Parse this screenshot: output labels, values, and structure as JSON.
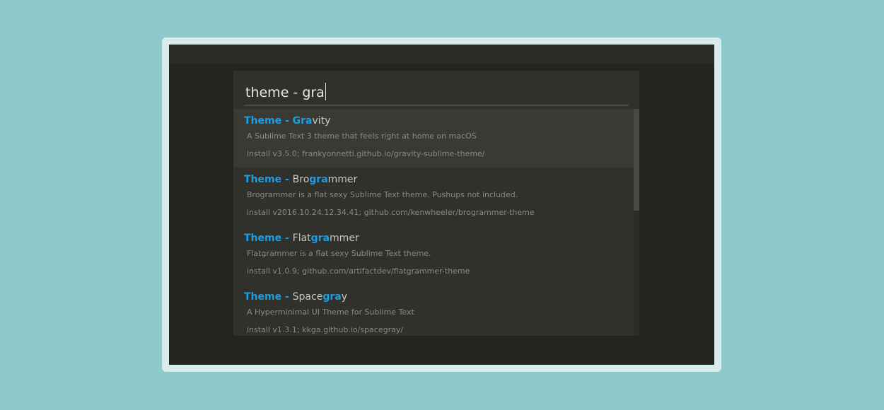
{
  "search": {
    "query": "theme - gra"
  },
  "results": [
    {
      "title_parts": [
        {
          "text": "Theme - ",
          "hl": true
        },
        {
          "text": "Gra",
          "hl": true
        },
        {
          "text": "vity",
          "hl": false
        }
      ],
      "description": "A Sublime Text 3 theme that feels right at home on macOS",
      "meta": "install v3.5.0; frankyonnetti.github.io/gravity-sublime-theme/",
      "selected": true
    },
    {
      "title_parts": [
        {
          "text": "Theme - ",
          "hl": true
        },
        {
          "text": "Bro",
          "hl": false
        },
        {
          "text": "gra",
          "hl": true
        },
        {
          "text": "mmer",
          "hl": false
        }
      ],
      "description": "Brogrammer is a flat sexy Sublime Text theme. Pushups not included.",
      "meta": "install v2016.10.24.12.34.41; github.com/kenwheeler/brogrammer-theme",
      "selected": false
    },
    {
      "title_parts": [
        {
          "text": "Theme - ",
          "hl": true
        },
        {
          "text": "Flat",
          "hl": false
        },
        {
          "text": "gra",
          "hl": true
        },
        {
          "text": "mmer",
          "hl": false
        }
      ],
      "description": "Flatgrammer is a flat sexy Sublime Text theme.",
      "meta": "install v1.0.9; github.com/artifactdev/flatgrammer-theme",
      "selected": false
    },
    {
      "title_parts": [
        {
          "text": "Theme - ",
          "hl": true
        },
        {
          "text": "Space",
          "hl": false
        },
        {
          "text": "gra",
          "hl": true
        },
        {
          "text": "y",
          "hl": false
        }
      ],
      "description": "A Hyperminimal UI Theme for Sublime Text",
      "meta": "install v1.3.1; kkga.github.io/spacegray/",
      "selected": false
    }
  ],
  "colors": {
    "accent": "#1a9ee6",
    "background": "#8ecaca",
    "palette": "#31312c",
    "selected_row": "#3a3a35"
  }
}
